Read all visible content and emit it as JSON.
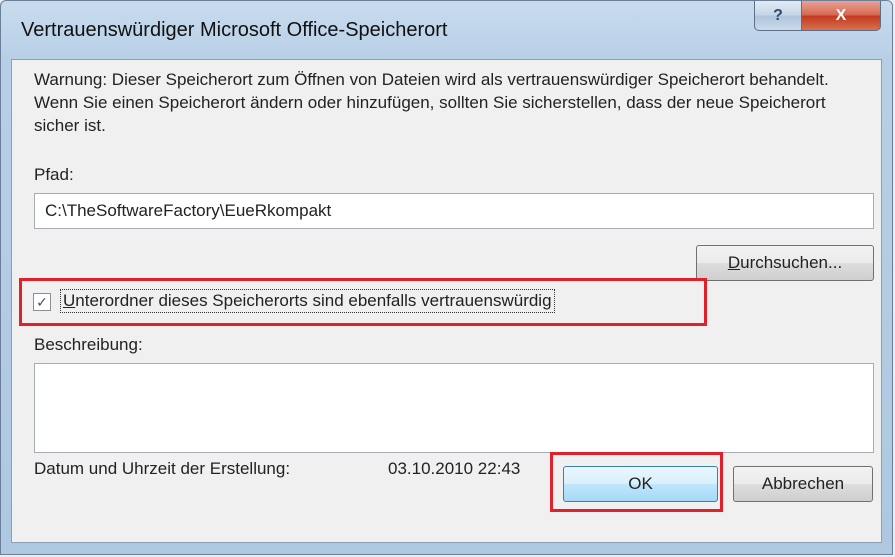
{
  "window": {
    "title": "Vertrauenswürdiger Microsoft Office-Speicherort",
    "help_icon": "?",
    "close_icon": "X"
  },
  "warning_text": "Warnung: Dieser Speicherort zum Öffnen von Dateien wird als vertrauenswürdiger Speicherort behandelt. Wenn Sie einen Speicherort ändern oder hinzufügen, sollten Sie sicherstellen, dass der neue Speicherort sicher ist.",
  "path": {
    "label": "Pfad:",
    "value": "C:\\TheSoftwareFactory\\EueRkompakt"
  },
  "browse_button": {
    "accel": "D",
    "rest": "urchsuchen..."
  },
  "subfolders_checkbox": {
    "checked": true,
    "check_glyph": "✓",
    "accel": "U",
    "rest": "nterordner dieses Speicherorts sind ebenfalls vertrauenswürdig"
  },
  "description": {
    "label": "Beschreibung:",
    "value": ""
  },
  "created": {
    "label": "Datum und Uhrzeit der Erstellung:",
    "value": "03.10.2010 22:43"
  },
  "ok_button": "OK",
  "cancel_button": "Abbrechen",
  "colors": {
    "highlight": "#e0202a"
  }
}
